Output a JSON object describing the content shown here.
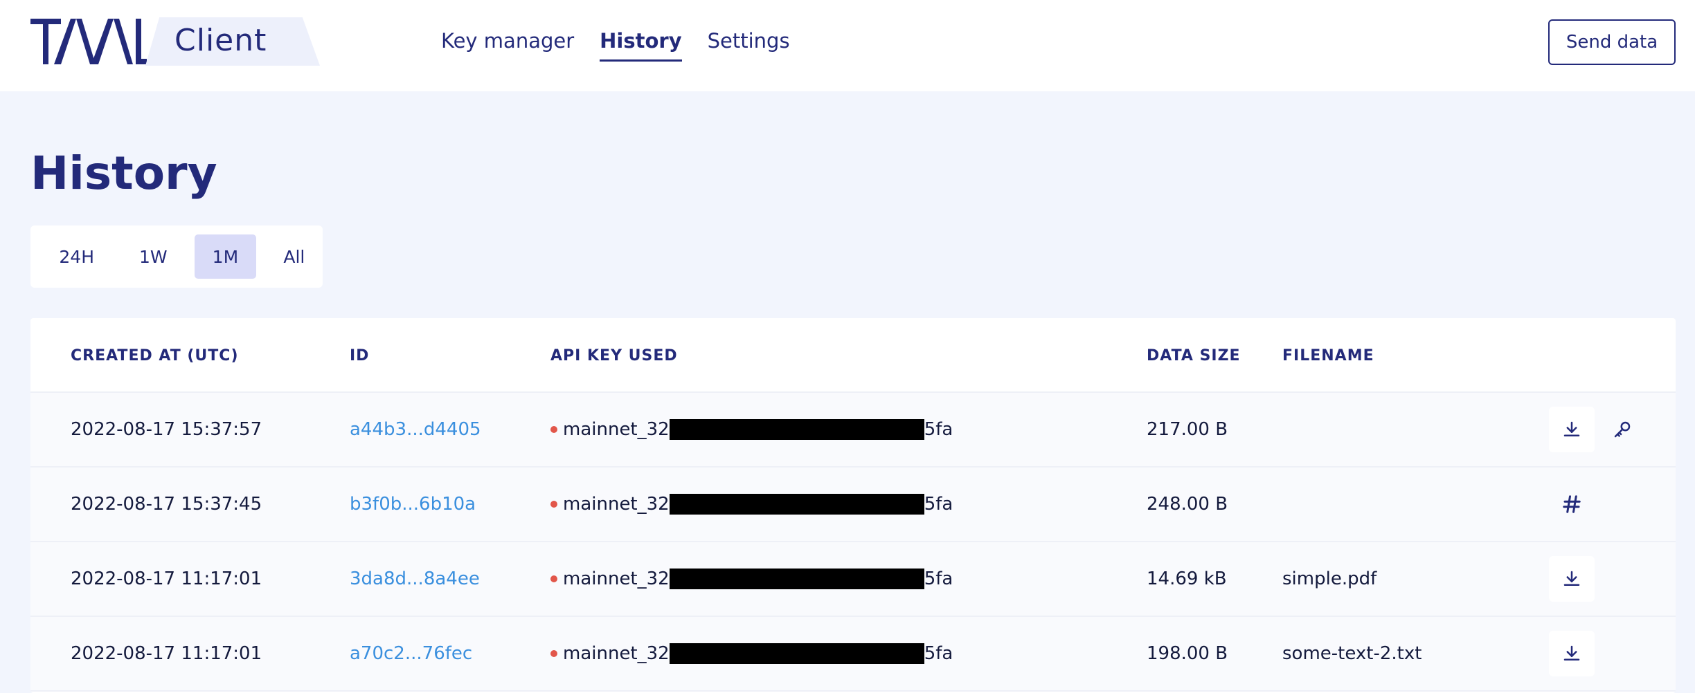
{
  "brand": {
    "logo_text": "TAAL",
    "product": "Client"
  },
  "nav": {
    "items": [
      {
        "label": "Key manager",
        "active": false
      },
      {
        "label": "History",
        "active": true
      },
      {
        "label": "Settings",
        "active": false
      }
    ],
    "send_button": "Send data"
  },
  "page": {
    "title": "History"
  },
  "filters": {
    "options": [
      "24H",
      "1W",
      "1M",
      "All"
    ],
    "selected": "1M"
  },
  "table": {
    "headers": {
      "created_at": "CREATED AT (UTC)",
      "id": "ID",
      "api_key": "API KEY USED",
      "data_size": "DATA SIZE",
      "filename": "FILENAME"
    },
    "rows": [
      {
        "created_at": "2022-08-17 15:37:57",
        "id": "a44b3...d4405",
        "api_key_prefix": "mainnet_32",
        "api_key_suffix": "5fa",
        "data_size": "217.00 B",
        "filename": "",
        "actions": [
          "download-icon",
          "key-icon"
        ]
      },
      {
        "created_at": "2022-08-17 15:37:45",
        "id": "b3f0b...6b10a",
        "api_key_prefix": "mainnet_32",
        "api_key_suffix": "5fa",
        "data_size": "248.00 B",
        "filename": "",
        "actions": [
          "hash-icon"
        ]
      },
      {
        "created_at": "2022-08-17 11:17:01",
        "id": "3da8d...8a4ee",
        "api_key_prefix": "mainnet_32",
        "api_key_suffix": "5fa",
        "data_size": "14.69 kB",
        "filename": "simple.pdf",
        "actions": [
          "download-icon"
        ]
      },
      {
        "created_at": "2022-08-17 11:17:01",
        "id": "a70c2...76fec",
        "api_key_prefix": "mainnet_32",
        "api_key_suffix": "5fa",
        "data_size": "198.00 B",
        "filename": "some-text-2.txt",
        "actions": [
          "download-icon"
        ]
      }
    ]
  },
  "colors": {
    "brand": "#232a7a",
    "link": "#3a8fde",
    "status_dot": "#e2564a",
    "background": "#f2f5fd"
  }
}
